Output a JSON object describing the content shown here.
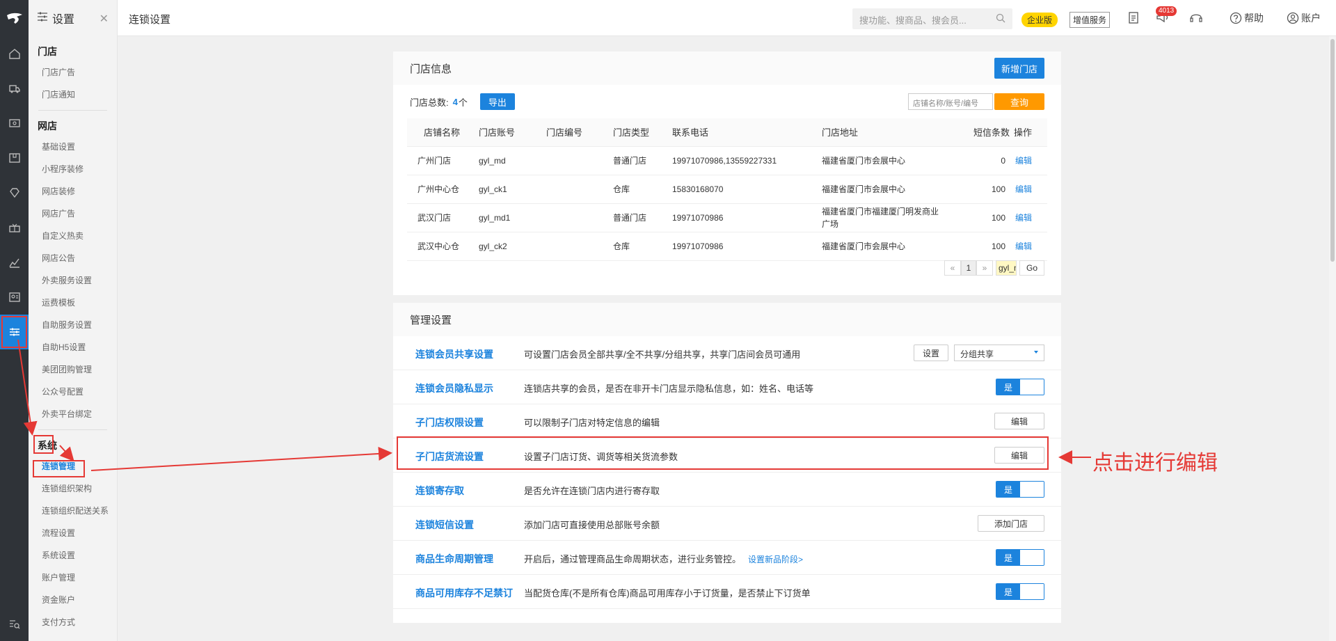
{
  "sidebar": {
    "title": "设置",
    "groups": [
      {
        "label": "门店",
        "items": [
          "门店广告",
          "门店通知"
        ]
      },
      {
        "label": "网店",
        "items": [
          "基础设置",
          "小程序装修",
          "网店装修",
          "网店广告",
          "自定义热卖",
          "网店公告",
          "外卖服务设置",
          "运费模板",
          "自助服务设置",
          "自助H5设置",
          "美团团购管理",
          "公众号配置",
          "外卖平台绑定"
        ]
      },
      {
        "label": "系统",
        "items": [
          "连锁管理",
          "连锁组织架构",
          "连锁组织配送关系",
          "流程设置",
          "系统设置",
          "账户管理",
          "资金账户",
          "支付方式"
        ]
      }
    ]
  },
  "topbar": {
    "title": "连锁设置",
    "search_placeholder": "搜功能、搜商品、搜会员...",
    "edition_badge": "企业版",
    "vas_label": "增值服务",
    "notice_count": "4013",
    "help_label": "帮助",
    "account_label": "账户"
  },
  "store_info": {
    "title": "门店信息",
    "add_button": "新增门店",
    "total_label": "门店总数:",
    "total_value": "4",
    "total_unit": "个",
    "export_button": "导出",
    "search_placeholder": "店铺名称/账号/编号",
    "query_button": "查询",
    "columns": [
      "店铺名称",
      "门店账号",
      "门店编号",
      "门店类型",
      "联系电话",
      "门店地址",
      "短信条数",
      "操作"
    ],
    "rows": [
      {
        "name": "广州门店",
        "account": "gyl_md",
        "code": "",
        "type": "普通门店",
        "phone": "19971070986,13559227331",
        "address": "福建省厦门市会展中心",
        "sms": "0",
        "op": "编辑"
      },
      {
        "name": "广州中心仓",
        "account": "gyl_ck1",
        "code": "",
        "type": "仓库",
        "phone": "15830168070",
        "address": "福建省厦门市会展中心",
        "sms": "100",
        "op": "编辑"
      },
      {
        "name": "武汉门店",
        "account": "gyl_md1",
        "code": "",
        "type": "普通门店",
        "phone": "19971070986",
        "address": "福建省厦门市福建厦门明发商业广场",
        "sms": "100",
        "op": "编辑"
      },
      {
        "name": "武汉中心仓",
        "account": "gyl_ck2",
        "code": "",
        "type": "仓库",
        "phone": "19971070986",
        "address": "福建省厦门市会展中心",
        "sms": "100",
        "op": "编辑"
      }
    ],
    "pager": {
      "prev": "«",
      "page": "1",
      "next": "»",
      "jump_value": "gyl_md",
      "go": "Go"
    }
  },
  "mgmt": {
    "title": "管理设置",
    "rows": [
      {
        "name": "连锁会员共享设置",
        "desc": "可设置门店会员全部共享/全不共享/分组共享，共享门店间会员可通用",
        "control": "select",
        "button": "设置",
        "select_value": "分组共享"
      },
      {
        "name": "连锁会员隐私显示",
        "desc": "连锁店共享的会员，是否在非开卡门店显示隐私信息，如：姓名、电话等",
        "control": "toggle",
        "toggle_label": "是"
      },
      {
        "name": "子门店权限设置",
        "desc": "可以限制子门店对特定信息的编辑",
        "control": "button",
        "button": "编辑"
      },
      {
        "name": "子门店货流设置",
        "desc": "设置子门店订货、调货等相关货流参数",
        "control": "button",
        "button": "编辑"
      },
      {
        "name": "连锁寄存取",
        "desc": "是否允许在连锁门店内进行寄存取",
        "control": "toggle",
        "toggle_label": "是"
      },
      {
        "name": "连锁短信设置",
        "desc": "添加门店可直接使用总部账号余额",
        "control": "button",
        "button": "添加门店"
      },
      {
        "name": "商品生命周期管理",
        "desc": "开启后，通过管理商品生命周期状态，进行业务管控。",
        "link": "设置新品阶段>",
        "control": "toggle",
        "toggle_label": "是"
      },
      {
        "name": "商品可用库存不足禁订",
        "desc": "当配货仓库(不是所有仓库)商品可用库存小于订货量，是否禁止下订货单",
        "control": "toggle",
        "toggle_label": "是"
      }
    ]
  },
  "annotation": {
    "text": "点击进行编辑",
    "color": "#e53935"
  },
  "colors": {
    "accent": "#1c83dd",
    "orange": "#ff9900",
    "rail": "#2f3338",
    "annotation": "#e53935"
  }
}
